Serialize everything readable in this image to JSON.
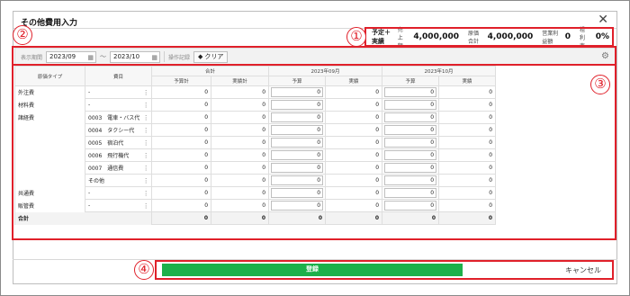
{
  "dialog": {
    "title": "その他費用入力"
  },
  "summary": {
    "label": "予定＋実績",
    "sales_label": "売上額",
    "sales_value": "4,000,000",
    "cost_label": "原価合計",
    "cost_value": "4,000,000",
    "opprofit_label": "営業利益額",
    "opprofit_value": "0",
    "margin_label": "粗利率",
    "margin_value": "0%"
  },
  "toolbar": {
    "period_label": "表示期間",
    "date_from": "2023/09",
    "tilde": "～",
    "date_to": "2023/10",
    "history_label": "操作記録",
    "clear_label": "クリア"
  },
  "table": {
    "headers": {
      "cost_type": "原価タイプ",
      "item": "費目",
      "total": "合計",
      "m1": "2023年09月",
      "m2": "2023年10月",
      "budget_total": "予算計",
      "actual_total": "実績計",
      "budget": "予算",
      "actual": "実績"
    },
    "rows": [
      {
        "cat": "外注費",
        "item": "-",
        "v": [
          "0",
          "0",
          "0",
          "0",
          "0",
          "0"
        ]
      },
      {
        "cat": "材料費",
        "item": "-",
        "v": [
          "0",
          "0",
          "0",
          "0",
          "0",
          "0"
        ]
      },
      {
        "cat": "諸経費",
        "item": "0003　電車・バス代",
        "v": [
          "0",
          "0",
          "0",
          "0",
          "0",
          "0"
        ]
      },
      {
        "cat": "",
        "item": "0004　タクシー代",
        "v": [
          "0",
          "0",
          "0",
          "0",
          "0",
          "0"
        ]
      },
      {
        "cat": "",
        "item": "0005　宿泊代",
        "v": [
          "0",
          "0",
          "0",
          "0",
          "0",
          "0"
        ]
      },
      {
        "cat": "",
        "item": "0006　飛行機代",
        "v": [
          "0",
          "0",
          "0",
          "0",
          "0",
          "0"
        ]
      },
      {
        "cat": "",
        "item": "0007　通信費",
        "v": [
          "0",
          "0",
          "0",
          "0",
          "0",
          "0"
        ]
      },
      {
        "cat": "",
        "item": "その他",
        "v": [
          "0",
          "0",
          "0",
          "0",
          "0",
          "0"
        ]
      },
      {
        "cat": "共通費",
        "item": "-",
        "v": [
          "0",
          "0",
          "0",
          "0",
          "0",
          "0"
        ]
      },
      {
        "cat": "販管費",
        "item": "-",
        "v": [
          "0",
          "0",
          "0",
          "0",
          "0",
          "0"
        ]
      }
    ],
    "total_row": {
      "label": "合計",
      "v": [
        "0",
        "0",
        "0",
        "0",
        "0",
        "0"
      ]
    }
  },
  "footer": {
    "register_label": "登録",
    "cancel_label": "キャンセル"
  },
  "annotations": {
    "n1": "①",
    "n2": "②",
    "n3": "③",
    "n4": "④"
  },
  "colors": {
    "accent_red": "#e0202a",
    "register_green": "#1db04a"
  }
}
